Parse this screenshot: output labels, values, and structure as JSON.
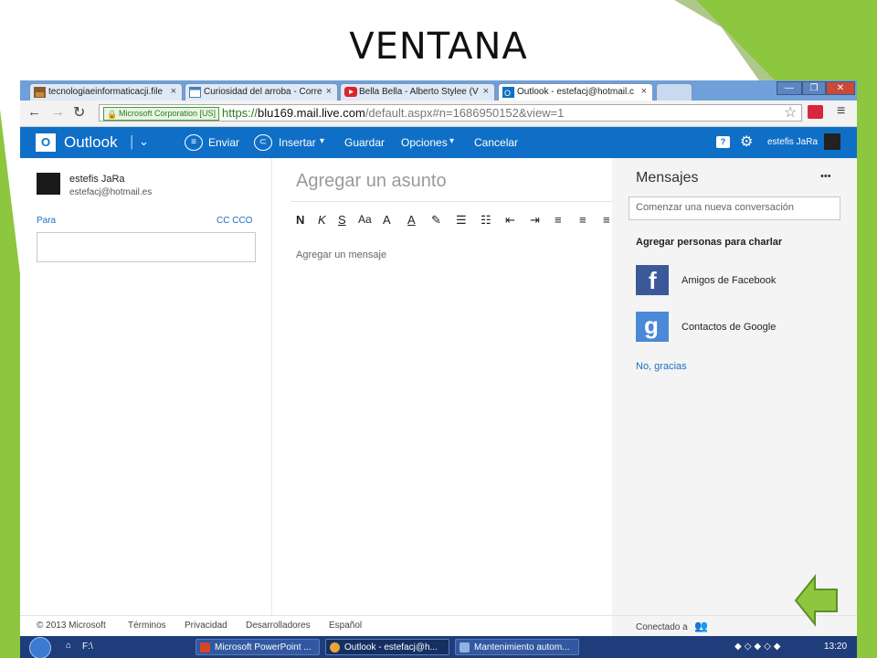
{
  "slide": {
    "title": "VENTANA"
  },
  "browser": {
    "tabs": [
      {
        "label": "tecnologiaeinformaticacji.file",
        "icon": "image-icon"
      },
      {
        "label": "Curiosidad del arroba - Corre",
        "icon": "page-icon"
      },
      {
        "label": "Bella Bella - Alberto Stylee (V",
        "icon": "youtube-icon"
      },
      {
        "label": "Outlook - estefacj@hotmail.c",
        "icon": "outlook-icon"
      }
    ],
    "tab_close": "×",
    "security_label": "Microsoft Corporation [US]",
    "url_scheme": "https://",
    "url_host": "blu169.mail.live.com",
    "url_path": "/default.aspx#n=1686950152&view=1"
  },
  "outlook": {
    "brand": "Outlook",
    "actions": {
      "send": "Enviar",
      "insert": "Insertar",
      "save": "Guardar",
      "options": "Opciones",
      "cancel": "Cancelar"
    },
    "user_name_header": "estefis JaRa",
    "sender": {
      "name": "estefis JaRa",
      "email": "estefacj@hotmail.es"
    },
    "to_label": "Para",
    "cc_label": "CC CCO",
    "subject_placeholder": "Agregar un asunto",
    "message_placeholder": "Agregar un mensaje",
    "format_tools": [
      "N",
      "K",
      "S",
      "Aa",
      "A",
      "A"
    ]
  },
  "messenger": {
    "title": "Mensajes",
    "more": "•••",
    "new_conversation_placeholder": "Comenzar una nueva conversación",
    "add_people_heading": "Agregar personas para charlar",
    "facebook_label": "Amigos de Facebook",
    "google_label": "Contactos de Google",
    "no_thanks": "No, gracias",
    "connected_to": "Conectado a"
  },
  "footer": {
    "copyright": "© 2013 Microsoft",
    "terms": "Términos",
    "privacy": "Privacidad",
    "developers": "Desarrolladores",
    "language": "Español"
  },
  "taskbar": {
    "drive": "F:\\",
    "items": [
      "Microsoft PowerPoint ...",
      "Outlook - estefacj@h...",
      "Mantenimiento autom..."
    ],
    "clock": "13:20"
  },
  "colors": {
    "slide_accent": "#8dc63f",
    "outlook_blue": "#0f6fc6",
    "link_blue": "#1a6fc2",
    "facebook": "#3b5998",
    "taskbar": "#1f3d7a"
  }
}
